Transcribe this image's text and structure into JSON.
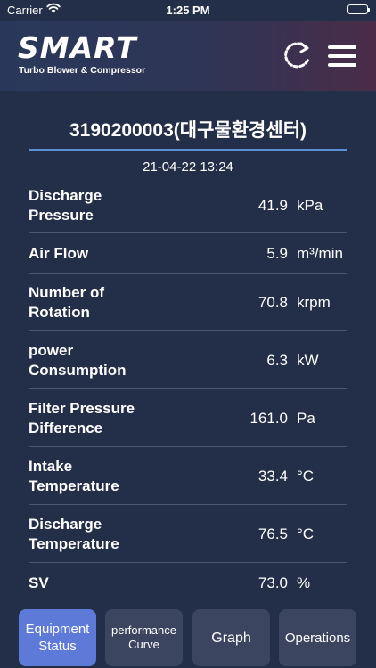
{
  "status_bar": {
    "carrier": "Carrier",
    "time": "1:25 PM",
    "wifi_icon": "wifi-icon",
    "battery_icon": "battery-icon"
  },
  "header": {
    "logo_text": "SMART",
    "logo_tagline": "Turbo Blower & Compressor",
    "refresh_icon": "refresh-icon",
    "menu_icon": "hamburger-menu-icon"
  },
  "device": {
    "title": "3190200003(대구물환경센터)",
    "timestamp": "21-04-22 13:24"
  },
  "measurements": [
    {
      "label_lines": [
        "Discharge",
        "Pressure"
      ],
      "value": "41.9",
      "unit": "kPa"
    },
    {
      "label_lines": [
        "Air Flow"
      ],
      "value": "5.9",
      "unit": "m³/min"
    },
    {
      "label_lines": [
        "Number of",
        "Rotation"
      ],
      "value": "70.8",
      "unit": "krpm"
    },
    {
      "label_lines": [
        "power",
        "Consumption"
      ],
      "value": "6.3",
      "unit": "kW"
    },
    {
      "label_lines": [
        "Filter Pressure",
        "Difference"
      ],
      "value": "161.0",
      "unit": "Pa"
    },
    {
      "label_lines": [
        "Intake",
        "Temperature"
      ],
      "value": "33.4",
      "unit": "°C"
    },
    {
      "label_lines": [
        "Discharge",
        "Temperature"
      ],
      "value": "76.5",
      "unit": "°C"
    },
    {
      "label_lines": [
        "SV"
      ],
      "value": "73.0",
      "unit": "%"
    }
  ],
  "tabs": [
    {
      "label_lines": [
        "Equipment",
        "Status"
      ],
      "active": true
    },
    {
      "label_lines": [
        "performance",
        "Curve"
      ],
      "active": false
    },
    {
      "label_lines": [
        "Graph"
      ],
      "active": false
    },
    {
      "label_lines": [
        "Operations"
      ],
      "active": false
    }
  ],
  "colors": {
    "background": "#232f48",
    "accent_rule": "#5b8fd6",
    "active_tab": "#5e7ad9",
    "inactive_tab": "#3b4560",
    "divider": "#4a5570"
  }
}
